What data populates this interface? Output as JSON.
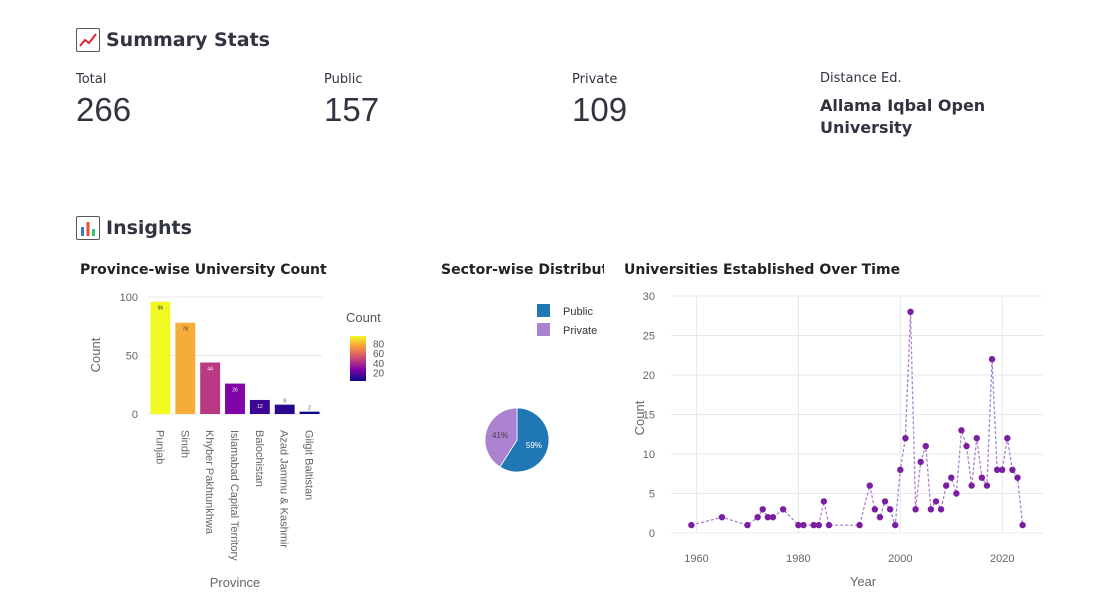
{
  "summary": {
    "title": "Summary Stats",
    "metrics": [
      {
        "label": "Total",
        "value": "266"
      },
      {
        "label": "Public",
        "value": "157"
      },
      {
        "label": "Private",
        "value": "109"
      },
      {
        "label": "Distance Ed.",
        "value": "Allama Iqbal Open University"
      }
    ]
  },
  "insights": {
    "title": "Insights"
  },
  "colors": {
    "public": "#1f77b4",
    "private": "#ab82d0",
    "line": "#7a1fa2"
  },
  "chart_data": [
    {
      "type": "bar",
      "title": "Province-wise University Count",
      "xlabel": "Province",
      "ylabel": "Count",
      "categories": [
        "Punjab",
        "Sindh",
        "Khyber Pakhtunkhwa",
        "Islamabad Capital Territory",
        "Balochistan",
        "Azad Jammu & Kashmir",
        "Gilgit Baltistan"
      ],
      "values": [
        96,
        78,
        44,
        26,
        12,
        8,
        2
      ],
      "ylim": [
        0,
        100
      ],
      "yticks": [
        0,
        50,
        100
      ],
      "colorbar": {
        "title": "Count",
        "ticks": [
          20,
          40,
          60,
          80
        ]
      },
      "grid": true
    },
    {
      "type": "pie",
      "title": "Sector-wise Distributio",
      "labels": [
        "Public",
        "Private"
      ],
      "values": [
        59,
        41
      ],
      "slice_labels": [
        "59%",
        "41%"
      ],
      "legend": "top-right"
    },
    {
      "type": "line",
      "title": "Universities Established Over Time",
      "xlabel": "Year",
      "ylabel": "Count",
      "x": [
        1959,
        1965,
        1970,
        1972,
        1973,
        1974,
        1975,
        1977,
        1980,
        1981,
        1983,
        1984,
        1985,
        1986,
        1992,
        1994,
        1995,
        1996,
        1997,
        1998,
        1999,
        2000,
        2001,
        2002,
        2003,
        2004,
        2005,
        2006,
        2007,
        2008,
        2009,
        2010,
        2011,
        2012,
        2013,
        2014,
        2015,
        2016,
        2017,
        2018,
        2019,
        2020,
        2021,
        2022,
        2023,
        2024
      ],
      "y": [
        1,
        2,
        1,
        2,
        3,
        2,
        2,
        3,
        1,
        1,
        1,
        1,
        4,
        1,
        1,
        6,
        3,
        2,
        4,
        3,
        1,
        8,
        12,
        28,
        3,
        9,
        11,
        3,
        4,
        3,
        6,
        7,
        5,
        13,
        11,
        6,
        12,
        7,
        6,
        22,
        8,
        8,
        12,
        8,
        7,
        1
      ],
      "xlim": [
        1955,
        2028
      ],
      "ylim": [
        0,
        30
      ],
      "xticks": [
        1960,
        1980,
        2000,
        2020
      ],
      "yticks": [
        0,
        5,
        10,
        15,
        20,
        25,
        30
      ],
      "grid": true
    }
  ]
}
